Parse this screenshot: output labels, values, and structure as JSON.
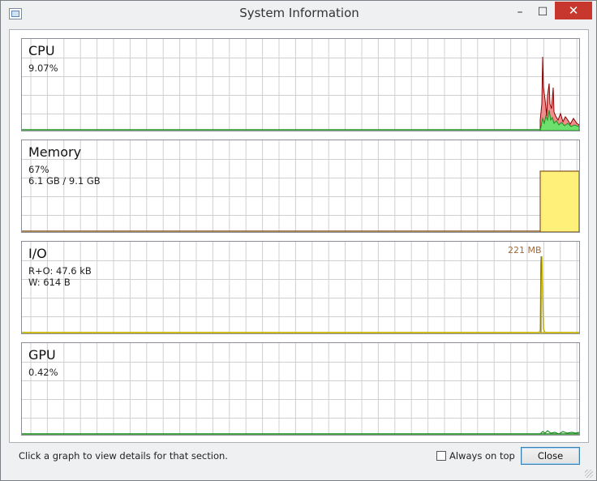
{
  "window": {
    "title": "System Information",
    "controls": {
      "minimize": "–",
      "maximize": "☐",
      "close": "✕"
    }
  },
  "panels": [
    {
      "name": "CPU",
      "lines": [
        "9.07%"
      ],
      "peak_label": ""
    },
    {
      "name": "Memory",
      "lines": [
        "67%",
        "6.1 GB / 9.1 GB"
      ],
      "peak_label": ""
    },
    {
      "name": "I/O",
      "lines": [
        "R+O: 47.6 kB",
        "W: 614 B"
      ],
      "peak_label": "221 MB"
    },
    {
      "name": "GPU",
      "lines": [
        "0.42%"
      ],
      "peak_label": ""
    }
  ],
  "footer": {
    "status": "Click a graph to view details for that section.",
    "always_on_top_label": "Always on top",
    "always_on_top_checked": false,
    "close_button": "Close"
  },
  "colors": {
    "grid": "#d0d0d0",
    "cpu_kernel": "#ef8d8d",
    "cpu_kernel_line": "#8a0000",
    "cpu_user": "#6ee06e",
    "cpu_user_line": "#1f8f1f",
    "memory_fill": "#fff07a",
    "memory_line": "#8a5a20",
    "io_line": "#c8b400",
    "gpu_line": "#1f8f1f"
  }
}
